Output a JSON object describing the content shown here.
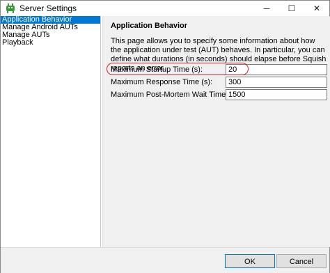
{
  "window": {
    "title": "Server Settings",
    "controls": {
      "minimize": "─",
      "maximize": "☐",
      "close": "✕"
    },
    "icon": "squish-app-icon"
  },
  "sidebar": {
    "items": [
      {
        "label": "Application Behavior",
        "selected": true
      },
      {
        "label": "Manage Android AUTs",
        "selected": false
      },
      {
        "label": "Manage AUTs",
        "selected": false
      },
      {
        "label": "Playback",
        "selected": false
      }
    ]
  },
  "panel": {
    "title": "Application Behavior",
    "description": "This page allows you to specify some information about how the application under test (AUT) behaves. In particular, you can define what durations (in seconds) should elapse before Squish reports an error.",
    "fields": [
      {
        "label": "Maximum Startup Time (s):",
        "value": "20",
        "highlighted": true
      },
      {
        "label": "Maximum Response Time (s):",
        "value": "300",
        "highlighted": false
      },
      {
        "label": "Maximum Post-Mortem Wait Time (ms):",
        "value": "1500",
        "highlighted": false
      }
    ]
  },
  "footer": {
    "ok_label": "OK",
    "cancel_label": "Cancel"
  },
  "colors": {
    "selection": "#0078d7",
    "highlight_oval": "#d0202a",
    "panel_bg": "#f0f0f0",
    "icon_green": "#3a9a3a"
  }
}
